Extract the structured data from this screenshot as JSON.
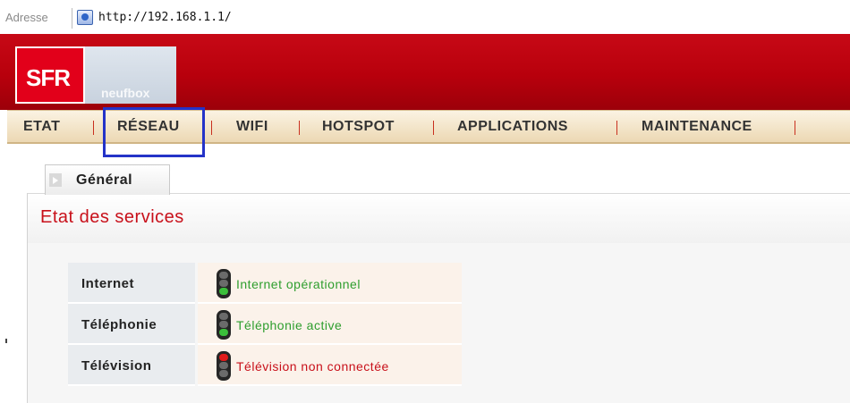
{
  "browser": {
    "address_label": "Adresse",
    "url": "http://192.168.1.1/",
    "page_icon": "ie-page-icon"
  },
  "brand": {
    "logo_text": "SFR",
    "sub_logo_text": "neufbox"
  },
  "nav": {
    "items": [
      {
        "label": "ETAT"
      },
      {
        "label": "RÉSEAU",
        "highlighted": true
      },
      {
        "label": "WIFI"
      },
      {
        "label": "HOTSPOT"
      },
      {
        "label": "APPLICATIONS"
      },
      {
        "label": "MAINTENANCE"
      }
    ],
    "highlight_color": "#2433c8"
  },
  "tabs": [
    {
      "label": "Général",
      "active": true
    }
  ],
  "section": {
    "title": "Etat des services"
  },
  "services": [
    {
      "name": "Internet",
      "status": "Internet opérationnel",
      "light": "green",
      "status_color": "#2e9e2e"
    },
    {
      "name": "Téléphonie",
      "status": "Téléphonie active",
      "light": "green",
      "status_color": "#2e9e2e"
    },
    {
      "name": "Télévision",
      "status": "Télévision non connectée",
      "light": "red",
      "status_color": "#c8101a"
    }
  ],
  "colors": {
    "header_red": "#b8000c",
    "accent_red": "#c8101a",
    "nav_bg": "#f3e6cc",
    "light_green": "#3bbf3b",
    "light_red": "#e01b1b"
  }
}
